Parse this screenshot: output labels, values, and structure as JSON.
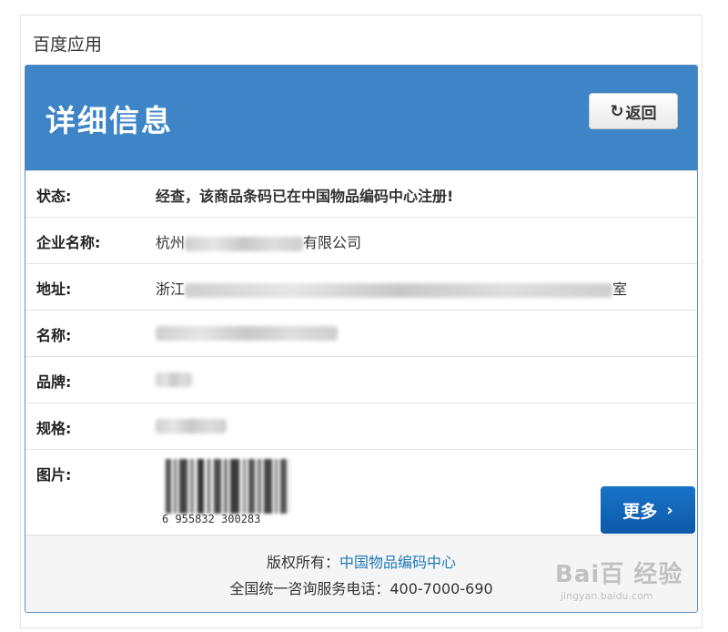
{
  "app": {
    "title": "百度应用"
  },
  "card": {
    "title": "详细信息",
    "back_label": "返回",
    "more_label": "更多"
  },
  "rows": [
    {
      "label": "状态:",
      "value": "经查，该商品条码已在中国物品编码中心注册!"
    },
    {
      "label": "企业名称:",
      "value_prefix": "杭州",
      "value_suffix": "有限公司"
    },
    {
      "label": "地址:",
      "value_prefix": "浙江",
      "value_suffix": "室"
    },
    {
      "label": "名称:"
    },
    {
      "label": "品牌:"
    },
    {
      "label": "规格:"
    },
    {
      "label": "图片:"
    }
  ],
  "barcode": {
    "digits": "6 955832 300283"
  },
  "footer": {
    "copyright_prefix": "版权所有：",
    "copyright_link": "中国物品编码中心",
    "hotline_label": "全国统一咨询服务电话：",
    "hotline_number": "400-7000-690"
  },
  "watermark": {
    "main": "Bai百 经验",
    "sub": "jingyan.baidu.com"
  },
  "colors": {
    "header": "#3d85c6",
    "more_button": "#1167bd",
    "link": "#1f7ab8"
  }
}
